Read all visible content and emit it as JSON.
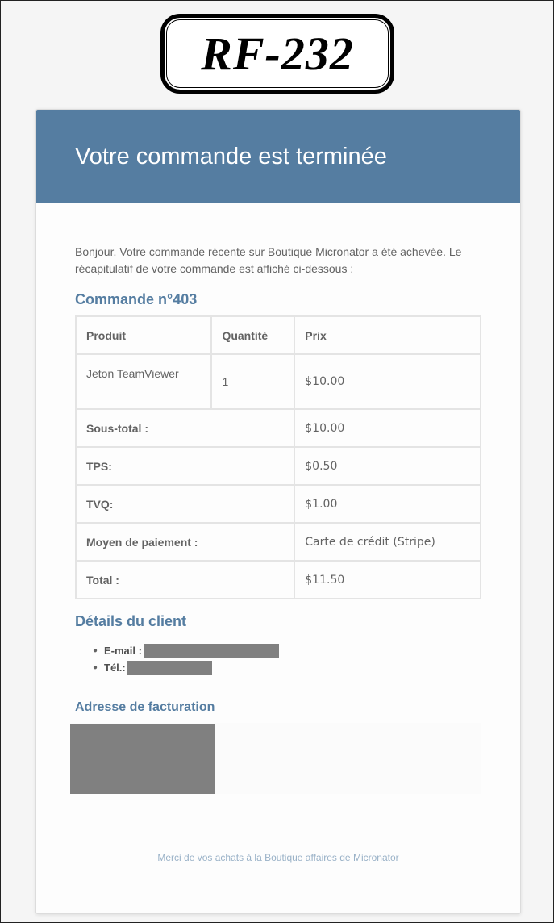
{
  "logo": {
    "text": "RF-232"
  },
  "header": {
    "title": "Votre commande est terminée"
  },
  "intro": "Bonjour. Votre commande récente sur Boutique Micronator a été achevée. Le récapitulatif de votre commande est affiché ci-dessous :",
  "order": {
    "title": "Commande n°403",
    "columns": [
      "Produit",
      "Quantité",
      "Prix"
    ],
    "items": [
      {
        "product": "Jeton TeamViewer",
        "quantity": "1",
        "price": "$10.00"
      }
    ],
    "totals": [
      {
        "label": "Sous-total :",
        "value": "$10.00"
      },
      {
        "label": "TPS:",
        "value": "$0.50"
      },
      {
        "label": "TVQ:",
        "value": "$1.00"
      },
      {
        "label": "Moyen de paiement :",
        "value": "Carte de crédit (Stripe)"
      },
      {
        "label": "Total :",
        "value": "$11.50"
      }
    ]
  },
  "client": {
    "title": "Détails du client",
    "email_label": "E-mail :",
    "phone_label": "Tél.:"
  },
  "billing": {
    "title": "Adresse de facturation"
  },
  "footer": "Merci de vos achats à la Boutique affaires de Micronator",
  "colors": {
    "accent": "#557da1",
    "redaction": "#808080"
  }
}
